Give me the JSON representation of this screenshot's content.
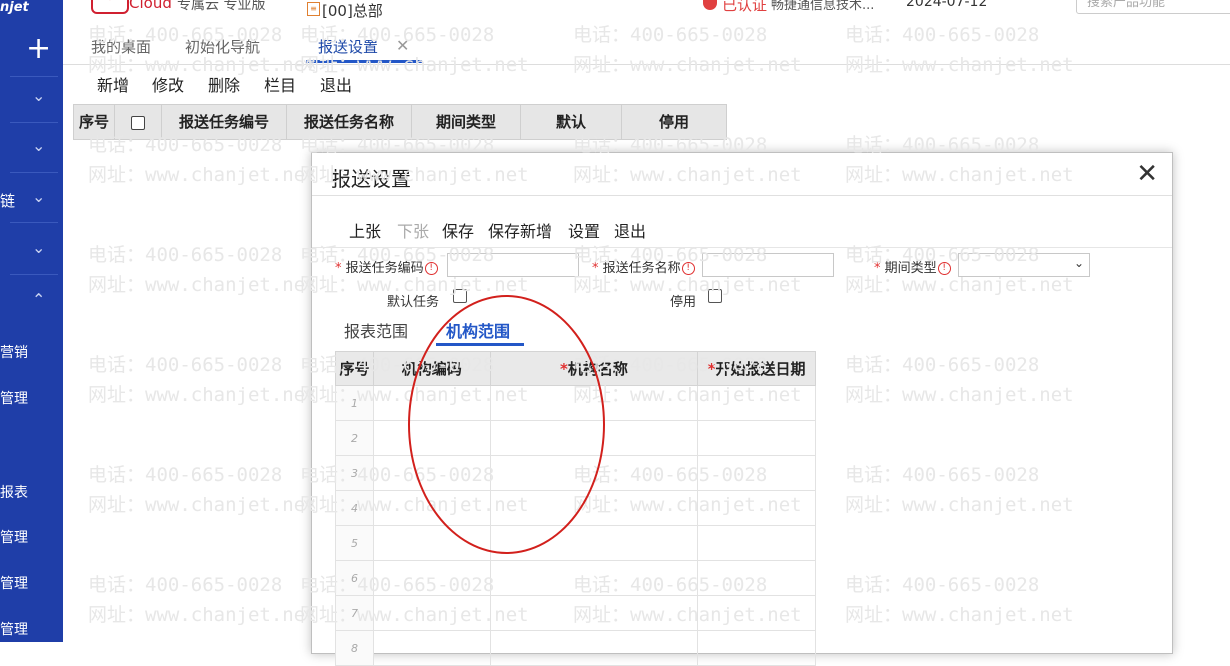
{
  "sidebar": {
    "brand": "njet",
    "items": [
      {
        "label": "",
        "chevron": "chevron-down"
      },
      {
        "label": "",
        "chevron": "chevron-down"
      },
      {
        "label": "链",
        "chevron": "chevron-down"
      },
      {
        "label": "",
        "chevron": "chevron-down"
      },
      {
        "label": "",
        "chevron": "chevron-up"
      }
    ],
    "links": [
      "营销",
      "管理",
      "报表",
      "管理",
      "管理",
      "管理"
    ]
  },
  "header": {
    "logo_text": "Cloud",
    "edition": "专属云 专业版",
    "org": "[00]总部",
    "certified": "已认证",
    "company": "畅捷通信息技术...",
    "date": "2024-07-12",
    "search_placeholder": "搜索产品功能"
  },
  "tabs": [
    {
      "label": "我的桌面",
      "active": false
    },
    {
      "label": "初始化导航",
      "active": false
    },
    {
      "label": "报送设置",
      "active": true
    }
  ],
  "toolbar": [
    "新增",
    "修改",
    "删除",
    "栏目",
    "退出"
  ],
  "bg_grid": {
    "columns": [
      "序号",
      "",
      "报送任务编号",
      "报送任务名称",
      "期间类型",
      "默认",
      "停用"
    ]
  },
  "modal": {
    "title": "报送设置",
    "toolbar": [
      {
        "label": "上张",
        "disabled": false
      },
      {
        "label": "下张",
        "disabled": true
      },
      {
        "label": "保存",
        "disabled": false
      },
      {
        "label": "保存新增",
        "disabled": false
      },
      {
        "label": "设置",
        "disabled": false
      },
      {
        "label": "退出",
        "disabled": false
      }
    ],
    "form": {
      "task_code_label": "报送任务编码",
      "task_name_label": "报送任务名称",
      "period_type_label": "期间类型",
      "default_task_label": "默认任务",
      "disabled_label": "停用",
      "task_code_value": "",
      "task_name_value": "",
      "period_type_value": ""
    },
    "subtabs": [
      {
        "label": "报表范围",
        "active": false
      },
      {
        "label": "机构范围",
        "active": true
      }
    ],
    "grid": {
      "columns": [
        "序号",
        "机构编码",
        "机构名称",
        "开始报送日期"
      ],
      "required": [
        false,
        false,
        true,
        true
      ],
      "rows": [
        "1",
        "2",
        "3",
        "4",
        "5",
        "6",
        "7",
        "8"
      ]
    }
  },
  "watermark": {
    "phone": "电话：400-665-0028",
    "site": "网址：www.chanjet.net"
  },
  "colors": {
    "sidebar": "#1f3ea8",
    "accent": "#2357c7",
    "required": "#e03030",
    "annotation": "#d2201c"
  }
}
